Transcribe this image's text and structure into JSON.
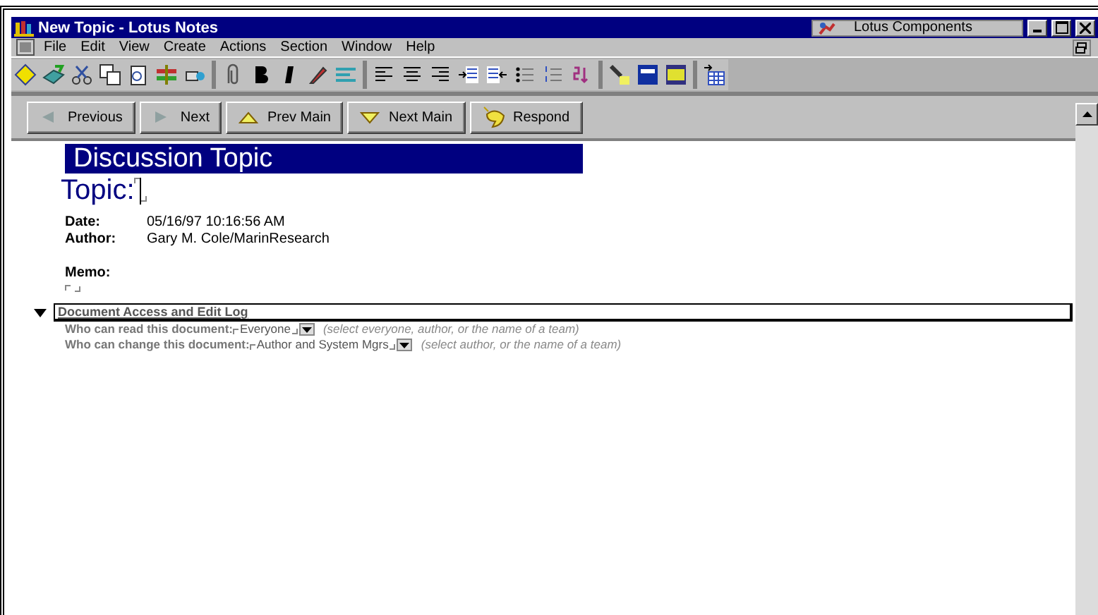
{
  "window": {
    "title": "New Topic - Lotus Notes",
    "component_label": "Lotus Components"
  },
  "menu": [
    "File",
    "Edit",
    "View",
    "Create",
    "Actions",
    "Section",
    "Window",
    "Help"
  ],
  "nav_buttons": [
    {
      "label": "Previous",
      "kind": "left"
    },
    {
      "label": "Next",
      "kind": "right"
    },
    {
      "label": "Prev Main",
      "kind": "up"
    },
    {
      "label": "Next Main",
      "kind": "down"
    },
    {
      "label": "Respond",
      "kind": "respond"
    }
  ],
  "form": {
    "heading": "Discussion Topic",
    "topic_label": "Topic:",
    "fields": [
      {
        "label": "Date:",
        "value": "05/16/97 10:16:56 AM"
      },
      {
        "label": "Author:",
        "value": "Gary M. Cole/MarinResearch"
      }
    ],
    "memo_label": "Memo:"
  },
  "section": {
    "title": "Document Access and Edit Log",
    "expanded": true,
    "rows": [
      {
        "label": "Who can read this document:",
        "value": "Everyone",
        "hint": "(select everyone, author, or the name of a team)"
      },
      {
        "label": "Who can change this document:",
        "value": "Author and System Mgrs",
        "hint": "(select author, or the name of a team)"
      }
    ]
  }
}
